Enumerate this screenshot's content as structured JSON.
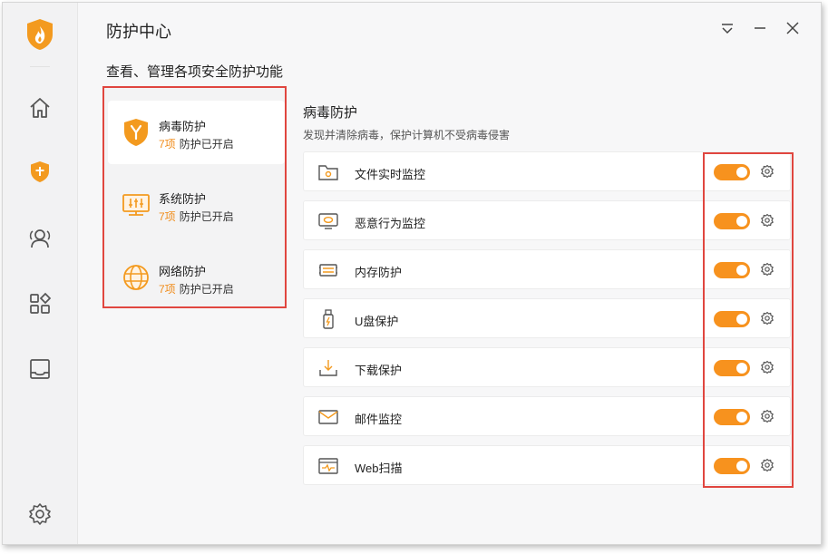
{
  "app": {
    "title": "防护中心",
    "subtitle": "查看、管理各项安全防护功能"
  },
  "colors": {
    "accent": "#f7921e",
    "highlight_border": "#e0463f",
    "count_text": "#f08c1b"
  },
  "sidebar": {
    "logo": "flame-shield-logo",
    "items": [
      {
        "icon": "home-icon"
      },
      {
        "icon": "shield-plus-icon",
        "active": true
      },
      {
        "icon": "users-icon"
      },
      {
        "icon": "apps-icon"
      },
      {
        "icon": "inbox-icon"
      }
    ],
    "footer_icon": "settings-icon"
  },
  "window_controls": [
    "menu-icon",
    "minimize-icon",
    "close-icon"
  ],
  "categories": [
    {
      "name": "病毒防护",
      "count": "7项",
      "status": "防护已开启",
      "icon": "virus-shield-icon",
      "active": true
    },
    {
      "name": "系统防护",
      "count": "7项",
      "status": "防护已开启",
      "icon": "system-monitor-icon"
    },
    {
      "name": "网络防护",
      "count": "7项",
      "status": "防护已开启",
      "icon": "network-globe-icon"
    }
  ],
  "section": {
    "title": "病毒防护",
    "description": "发现并清除病毒，保护计算机不受病毒侵害"
  },
  "features": [
    {
      "label": "文件实时监控",
      "icon": "folder-monitor-icon",
      "enabled": true
    },
    {
      "label": "恶意行为监控",
      "icon": "behavior-monitor-icon",
      "enabled": true
    },
    {
      "label": "内存防护",
      "icon": "memory-icon",
      "enabled": true
    },
    {
      "label": "U盘保护",
      "icon": "usb-icon",
      "enabled": true
    },
    {
      "label": "下载保护",
      "icon": "download-tray-icon",
      "enabled": true
    },
    {
      "label": "邮件监控",
      "icon": "mail-icon",
      "enabled": true
    },
    {
      "label": "Web扫描",
      "icon": "web-scan-icon",
      "enabled": true
    }
  ]
}
